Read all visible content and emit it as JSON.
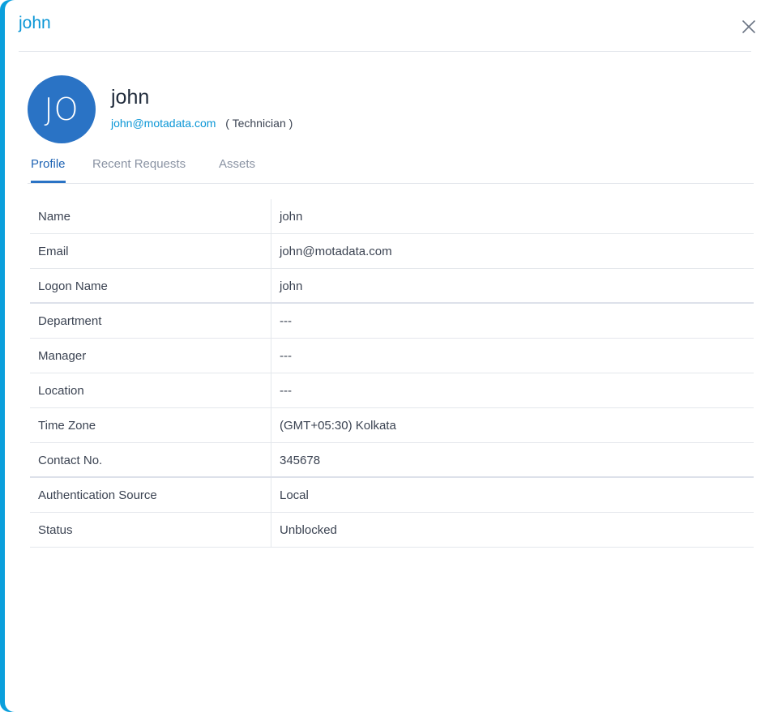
{
  "header": {
    "title": "john",
    "close_icon": "close-icon"
  },
  "profile": {
    "avatar_initials": "JO",
    "name": "john",
    "email": "john@motadata.com",
    "role": "( Technician )",
    "colors": {
      "accent": "#0a96d6",
      "avatar_bg": "#2a73c5",
      "active_tab": "#1f64b4"
    }
  },
  "tabs": [
    {
      "label": "Profile",
      "active": true
    },
    {
      "label": "Recent Requests",
      "active": false
    },
    {
      "label": "Assets",
      "active": false
    }
  ],
  "details": [
    {
      "key": "Name",
      "value": "john"
    },
    {
      "key": "Email",
      "value": "john@motadata.com"
    },
    {
      "key": "Logon Name",
      "value": "john"
    },
    {
      "key": "Department",
      "value": "---"
    },
    {
      "key": "Manager",
      "value": "---"
    },
    {
      "key": "Location",
      "value": "---"
    },
    {
      "key": "Time Zone",
      "value": "(GMT+05:30) Kolkata"
    },
    {
      "key": "Contact No.",
      "value": "345678"
    },
    {
      "key": "Authentication Source",
      "value": "Local"
    },
    {
      "key": "Status",
      "value": "Unblocked"
    }
  ]
}
